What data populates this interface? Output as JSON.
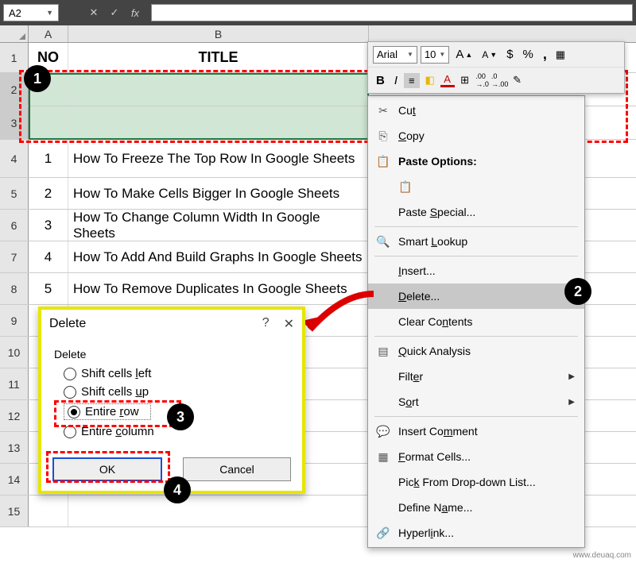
{
  "formula_bar": {
    "cell_ref": "A2",
    "cancel": "✕",
    "confirm": "✓",
    "fx": "fx"
  },
  "columns": {
    "A": "A",
    "B": "B"
  },
  "row_numbers": [
    "1",
    "2",
    "3",
    "4",
    "5",
    "6",
    "7",
    "8",
    "9",
    "10",
    "11",
    "12",
    "13",
    "14",
    "15"
  ],
  "header_row": {
    "no": "NO",
    "title": "TITLE"
  },
  "rows": [
    {
      "no": "1",
      "title": "How To Freeze The Top Row In Google Sheets"
    },
    {
      "no": "2",
      "title": "How To Make Cells Bigger In Google Sheets"
    },
    {
      "no": "3",
      "title": "How To Change Column Width In Google Sheets"
    },
    {
      "no": "4",
      "title": "How To Add And Build Graphs In Google Sheets"
    },
    {
      "no": "5",
      "title": "How To Remove Duplicates In Google Sheets"
    }
  ],
  "mini_toolbar": {
    "font": "Arial",
    "size": "10",
    "grow": "A",
    "shrink": "A",
    "dollar": "$",
    "percent": "%",
    "comma": ",",
    "bold": "B",
    "italic": "I",
    "align": "≡"
  },
  "context_menu": {
    "cut": "Cut",
    "copy": "Copy",
    "paste_options": "Paste Options:",
    "paste_special": "Paste Special...",
    "smart_lookup": "Smart Lookup",
    "insert": "Insert...",
    "delete": "Delete...",
    "clear": "Clear Contents",
    "quick_analysis": "Quick Analysis",
    "filter": "Filter",
    "sort": "Sort",
    "insert_comment": "Insert Comment",
    "format_cells": "Format Cells...",
    "pick_list": "Pick From Drop-down List...",
    "define_name": "Define Name...",
    "hyperlink": "Hyperlink..."
  },
  "dialog": {
    "title": "Delete",
    "help": "?",
    "close": "✕",
    "group": "Delete",
    "opt_left": "Shift cells left",
    "opt_up": "Shift cells up",
    "opt_row": "Entire row",
    "opt_col": "Entire column",
    "ok": "OK",
    "cancel": "Cancel"
  },
  "badges": {
    "b1": "1",
    "b2": "2",
    "b3": "3",
    "b4": "4"
  },
  "watermark": "www.deuaq.com"
}
